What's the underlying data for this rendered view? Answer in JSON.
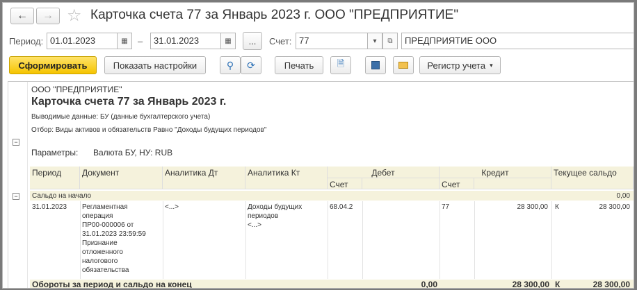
{
  "window": {
    "title": "Карточка счета 77 за Январь 2023 г. ООО \"ПРЕДПРИЯТИЕ\""
  },
  "nav": {
    "back_icon": "arrow-left",
    "forward_icon": "arrow-right",
    "favorite_icon": "star"
  },
  "filters": {
    "period_label": "Период:",
    "date_from": "01.01.2023",
    "dash": "–",
    "date_to": "31.01.2023",
    "more_label": "...",
    "account_label": "Счет:",
    "account_value": "77",
    "org_value": "ПРЕДПРИЯТИЕ ООО"
  },
  "toolbar": {
    "generate_label": "Сформировать",
    "settings_label": "Показать настройки",
    "print_label": "Печать",
    "register_label": "Регистр учета"
  },
  "report": {
    "org": "ООО \"ПРЕДПРИЯТИЕ\"",
    "title": "Карточка счета 77 за Январь 2023 г.",
    "output_data": "Выводимые данные: БУ (данные бухгалтерского учета)",
    "filter": "Отбор: Виды активов и обязательств Равно \"Доходы будущих периодов\"",
    "params_label": "Параметры:",
    "params_value": "Валюта БУ, НУ: RUB",
    "columns": {
      "period": "Период",
      "document": "Документ",
      "analytics_dt": "Аналитика Дт",
      "analytics_kt": "Аналитика Кт",
      "debit": "Дебет",
      "credit": "Кредит",
      "balance": "Текущее сальдо",
      "debit_account": "Счет",
      "credit_account": "Счет"
    },
    "opening": {
      "label": "Сальдо на начало",
      "value": "0,00"
    },
    "row": {
      "period": "31.01.2023",
      "document_lines": [
        "Регламентная",
        "операция",
        "ПР00-000006 от",
        "31.01.2023 23:59:59",
        "Признание",
        "отложенного",
        "налогового",
        "обязательства"
      ],
      "analytics_dt": "<...>",
      "analytics_kt_lines": [
        "Доходы будущих",
        "периодов",
        "<...>"
      ],
      "debit_account": "68.04.2",
      "credit_account": "77",
      "credit_amount": "28 300,00",
      "balance_side": "К",
      "balance_amount": "28 300,00"
    },
    "totals": {
      "label": "Обороты за период и сальдо на конец",
      "debit": "0,00",
      "credit": "28 300,00",
      "balance_side": "К",
      "balance_amount": "28 300,00"
    }
  }
}
